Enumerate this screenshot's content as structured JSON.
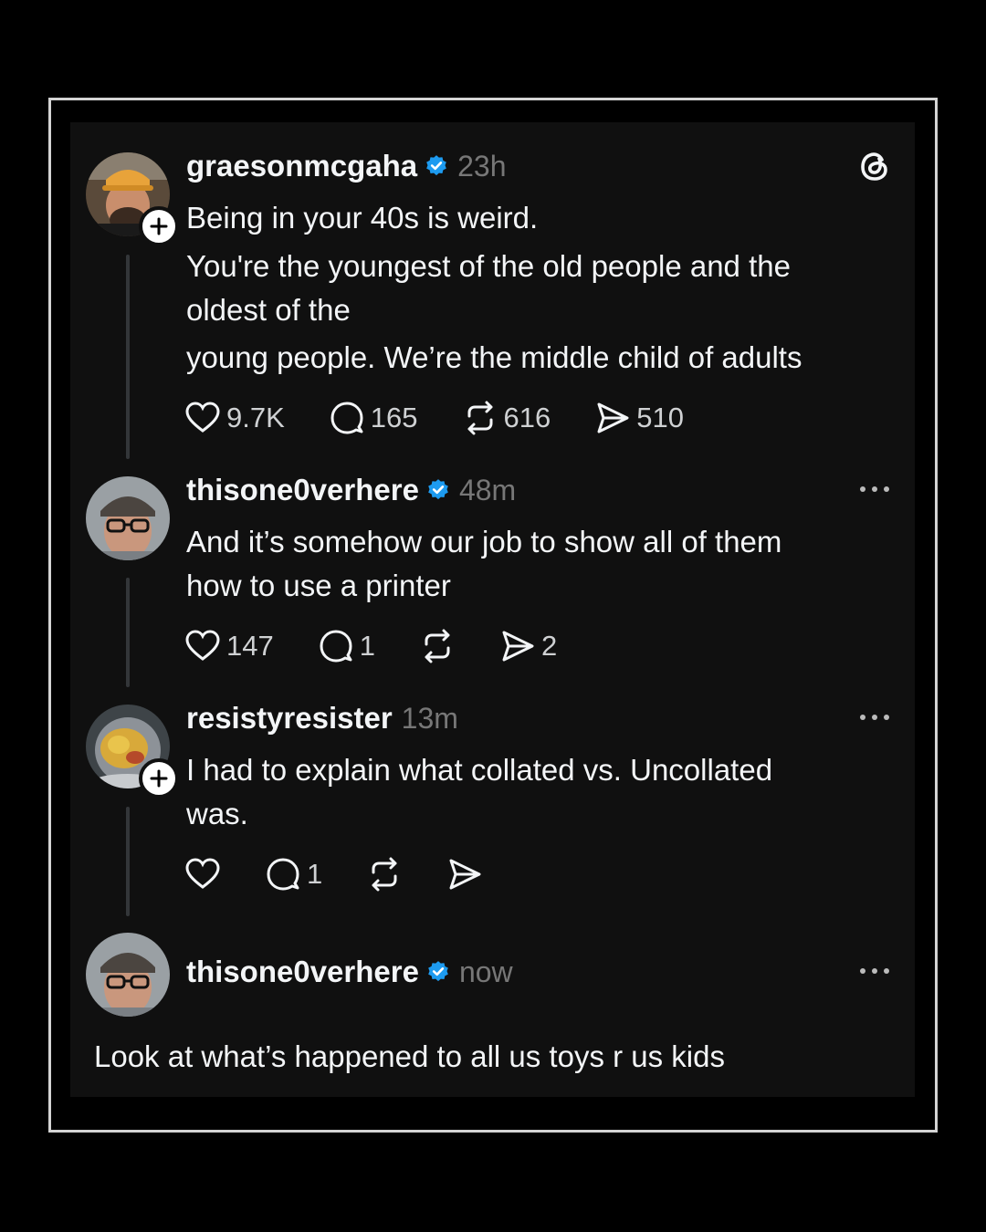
{
  "posts": [
    {
      "username": "graesonmcgaha",
      "verified": true,
      "time": "23h",
      "text_lines": [
        "Being in your 40s is weird.",
        "You're the youngest of the old people and the",
        "oldest of the",
        "young people. We’re the middle child of adults"
      ],
      "likes": "9.7K",
      "replies": "165",
      "reposts": "616",
      "shares": "510"
    },
    {
      "username": "thisone0verhere",
      "verified": true,
      "time": "48m",
      "text_lines": [
        "And it’s somehow our job to show all of them",
        "how to use a printer"
      ],
      "likes": "147",
      "replies": "1",
      "reposts": "",
      "shares": "2"
    },
    {
      "username": "resistyresister",
      "verified": false,
      "time": "13m",
      "text_lines": [
        "I had to explain what collated vs. Uncollated",
        "was."
      ],
      "likes": "",
      "replies": "1",
      "reposts": "",
      "shares": ""
    },
    {
      "username": "thisone0verhere",
      "verified": true,
      "time": "now",
      "text_lines": [
        "Look at what’s happened to all us toys r us kids"
      ]
    }
  ],
  "icons": {
    "app_logo": "threads-logo-icon",
    "verified": "verified-badge-icon",
    "like": "heart-icon",
    "reply": "comment-icon",
    "repost": "repost-icon",
    "share": "send-icon",
    "more": "more-options-icon",
    "follow": "plus-icon"
  },
  "colors": {
    "verified": "#1d9bf0",
    "panel": "#101010",
    "muted": "#777777"
  }
}
